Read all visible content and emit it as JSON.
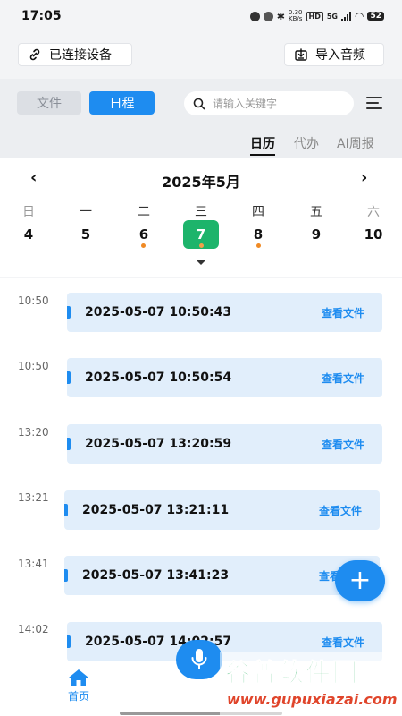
{
  "status_bar": {
    "time": "17:05",
    "net_speed": "0.30",
    "net_unit": "KB/s",
    "hd": "HD",
    "network": "5G",
    "battery": "52"
  },
  "top_bar": {
    "connect_label": "已连接设备",
    "import_label": "导入音频"
  },
  "tabs": {
    "file_label": "文件",
    "schedule_label": "日程"
  },
  "search": {
    "placeholder": "请输入关键字"
  },
  "view_tabs": {
    "calendar": "日历",
    "todo": "代办",
    "ai_weekly": "AI周报"
  },
  "calendar": {
    "month_title": "2025年5月",
    "weekdays": [
      "日",
      "一",
      "二",
      "三",
      "四",
      "五",
      "六"
    ],
    "days": [
      "4",
      "5",
      "6",
      "7",
      "8",
      "9",
      "10"
    ],
    "selected_index": 3,
    "dots_on": [
      2,
      3,
      4
    ]
  },
  "events": [
    {
      "time": "10:50",
      "title": "2025-05-07 10:50:43",
      "link": "查看文件"
    },
    {
      "time": "10:50",
      "title": "2025-05-07 10:50:54",
      "link": "查看文件"
    },
    {
      "time": "13:20",
      "title": "2025-05-07 13:20:59",
      "link": "查看文件"
    },
    {
      "time": "13:21",
      "title": "2025-05-07 13:21:11",
      "link": "查看文件"
    },
    {
      "time": "13:41",
      "title": "2025-05-07 13:41:23",
      "link": "查看文件"
    },
    {
      "time": "14:02",
      "title": "2025-05-07 14:02:57",
      "link": "查看文件"
    }
  ],
  "bottom_nav": {
    "home_label": "首页"
  },
  "watermark": {
    "line1": "谷普软件园",
    "line2": "www.gupuxiazai.com"
  },
  "colors": {
    "accent": "#1e8cf0",
    "selected_day": "#1db46b",
    "event_dot": "#f08a24",
    "card_bg": "#e1eefb"
  }
}
